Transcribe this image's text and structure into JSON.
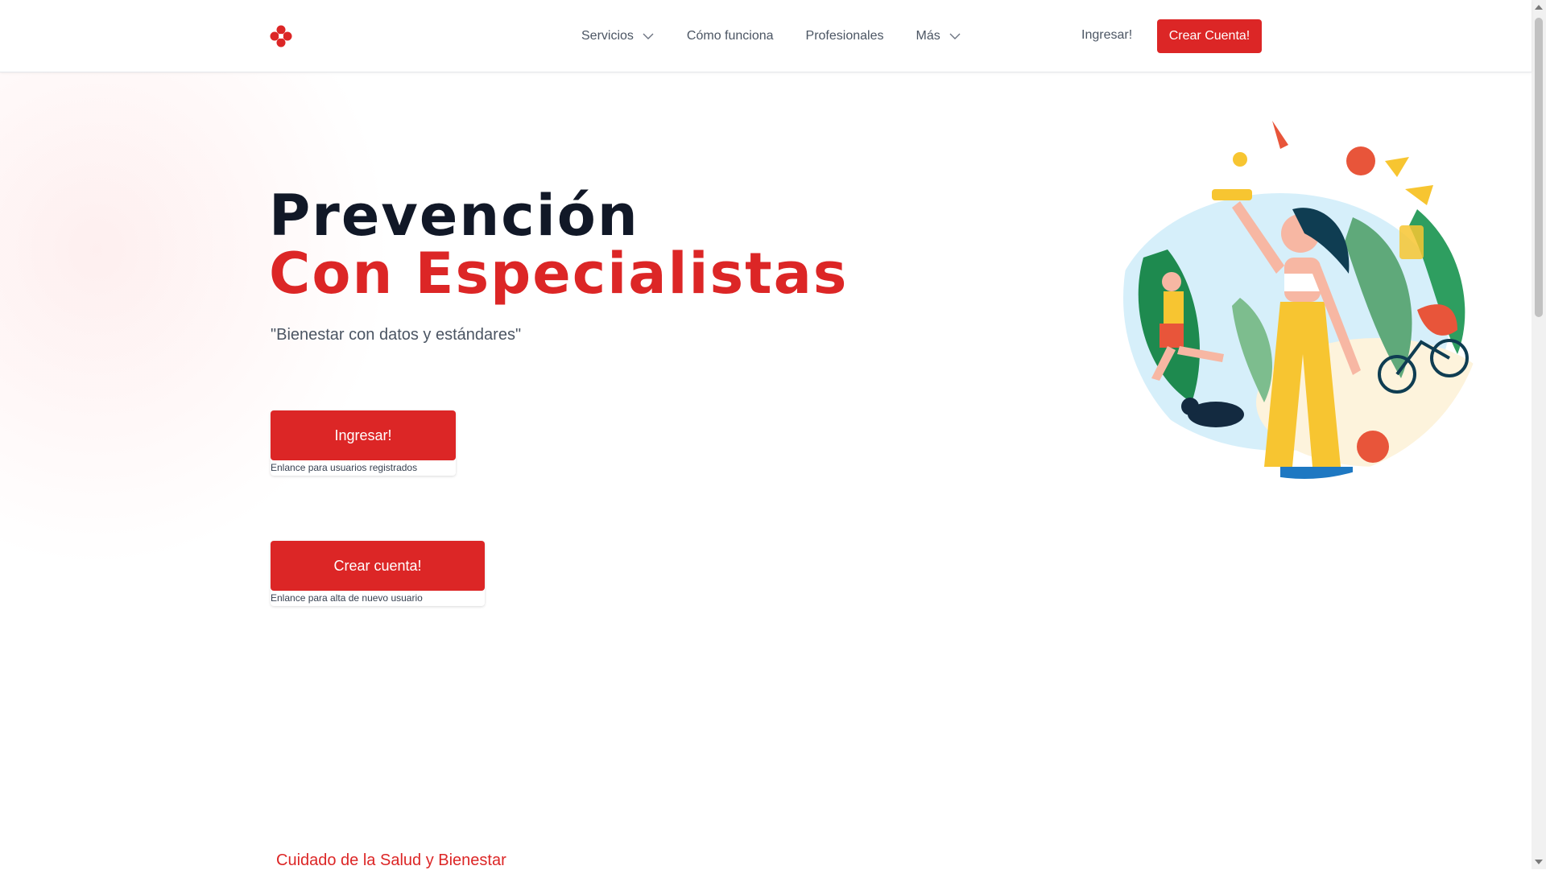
{
  "header": {
    "logo_icon": "red-flower-logo-icon",
    "nav": [
      {
        "label": "Servicios",
        "has_dropdown": true
      },
      {
        "label": "Cómo funciona",
        "has_dropdown": false
      },
      {
        "label": "Profesionales",
        "has_dropdown": false
      },
      {
        "label": "Más",
        "has_dropdown": true
      }
    ],
    "login_label": "Ingresar!",
    "signup_label": "Crear Cuenta!"
  },
  "hero": {
    "title_line1": "Prevención",
    "title_line2": "Con Especialistas",
    "tagline": "\"Bienestar con datos y estándares\"",
    "login_button": "Ingresar!",
    "login_note": "Enlance para usuarios registrados",
    "signup_button": "Crear cuenta!",
    "signup_note": "Enlance para alta de nuevo usuario",
    "illustration": "wellness-activities-illustration"
  },
  "sections": {
    "next_label": "Cuidado de la Salud y Bienestar"
  },
  "colors": {
    "accent": "#dc2626",
    "heading": "#111827",
    "text": "#4b5563"
  }
}
